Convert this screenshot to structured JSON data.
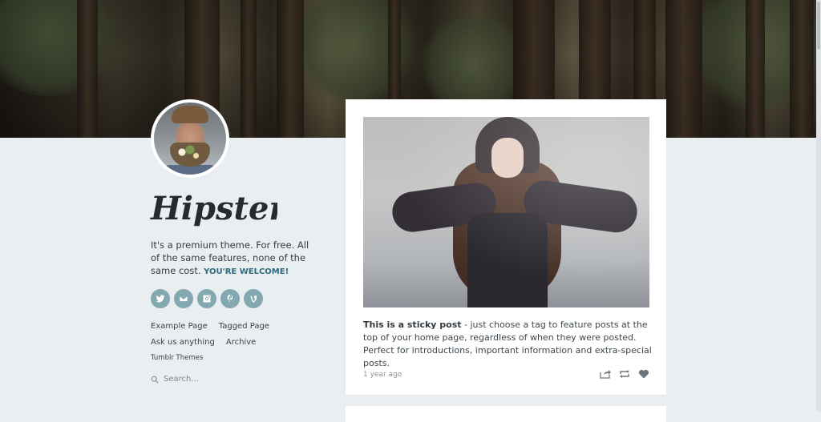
{
  "blog": {
    "title": "Hipster",
    "description_text": "It's a premium theme. For free. All of the same features, none of the same cost.",
    "description_highlight": "YOU'RE WELCOME!"
  },
  "social": [
    {
      "icon": "twitter-icon",
      "label": "Twitter"
    },
    {
      "icon": "email-icon",
      "label": "Email"
    },
    {
      "icon": "instagram-icon",
      "label": "Instagram"
    },
    {
      "icon": "pinterest-icon",
      "label": "Pinterest"
    },
    {
      "icon": "vine-icon",
      "label": "Vine"
    }
  ],
  "nav": {
    "example_page": "Example Page",
    "tagged_page": "Tagged Page",
    "ask": "Ask us anything",
    "archive": "Archive",
    "tumblr_themes": "Tumblr Themes"
  },
  "search": {
    "placeholder": "Search..."
  },
  "post": {
    "sticky_label": "This is a sticky post",
    "body": " - just choose a tag to feature posts at the top of your home page, regardless of when they were posted. Perfect for introductions, important information and extra-special posts.",
    "timestamp": "1 year ago",
    "actions": [
      "share-icon",
      "reblog-icon",
      "like-icon"
    ]
  },
  "colors": {
    "background": "#e9eef0",
    "social_button": "#83a8b0",
    "accent_link": "#2f6a80",
    "card": "#ffffff"
  }
}
